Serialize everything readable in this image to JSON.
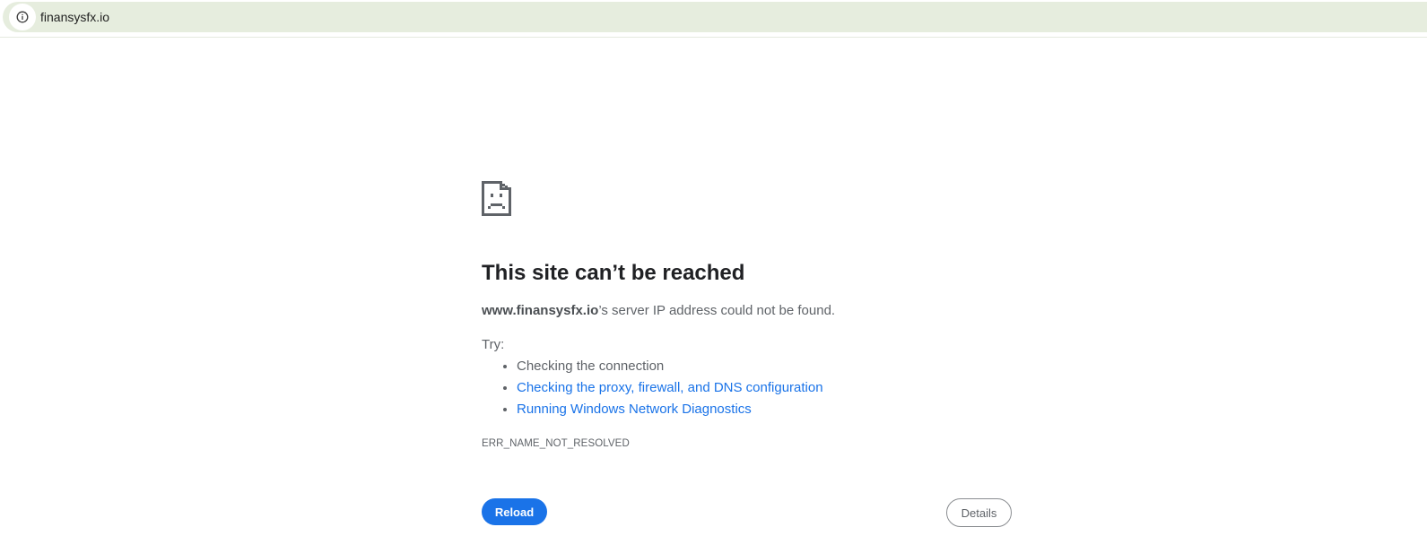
{
  "address_bar": {
    "url": "finansysfx.io",
    "info_icon": "info-icon"
  },
  "error_page": {
    "icon": "sad-page-icon",
    "heading": "This site can’t be reached",
    "summary_host": "www.finansysfx.io",
    "summary_rest": "’s server IP address could not be found.",
    "try_label": "Try:",
    "suggestions": [
      {
        "text": "Checking the connection",
        "is_link": false
      },
      {
        "text": "Checking the proxy, firewall, and DNS configuration",
        "is_link": true
      },
      {
        "text": "Running Windows Network Diagnostics",
        "is_link": true
      }
    ],
    "error_code": "ERR_NAME_NOT_RESOLVED",
    "reload_label": "Reload",
    "details_label": "Details"
  },
  "colors": {
    "omnibox_bg": "#e6edde",
    "accent": "#1a73e8",
    "text_primary": "#202124",
    "text_secondary": "#5f6368"
  }
}
